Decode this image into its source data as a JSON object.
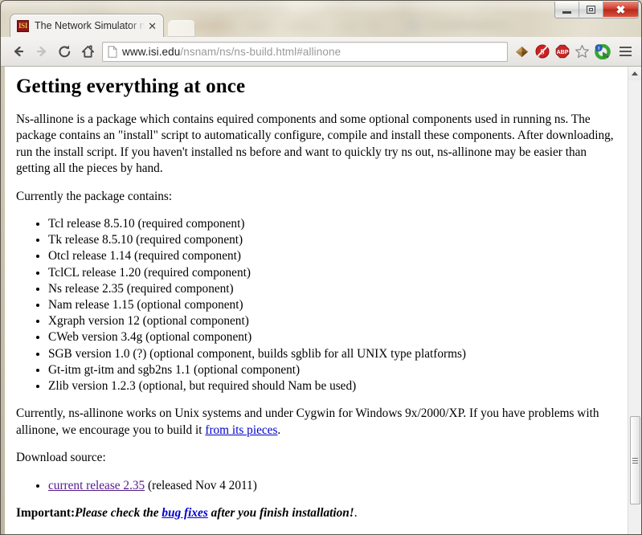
{
  "window": {
    "controls": [
      {
        "name": "minimize",
        "label": "–"
      },
      {
        "name": "restore",
        "label": "□"
      },
      {
        "name": "close",
        "label": "✕"
      }
    ]
  },
  "tab": {
    "favicon_text": "ISI",
    "favicon_name": "isi-favicon",
    "title": "The Network Simulator ns",
    "close_label": "✕",
    "newtab_label": ""
  },
  "toolbar": {
    "back_name": "back-icon",
    "forward_name": "forward-icon",
    "reload_name": "reload-icon",
    "home_name": "home-icon",
    "omnibox": {
      "page_icon_name": "page-document-icon",
      "url_domain": "www.isi.edu",
      "url_path": "/nsnam/ns/ns-build.html#allinone",
      "full_url": "www.isi.edu/nsnam/ns/ns-build.html#allinone"
    },
    "extensions": [
      {
        "name": "diamond-extension-icon",
        "color": "#a5763a"
      },
      {
        "name": "noscript-icon",
        "color": "#cc2222"
      },
      {
        "name": "adblock-plus-icon",
        "label": "ABP",
        "color": "#c62828"
      },
      {
        "name": "bookmark-star-icon",
        "color": "#8c8c8c"
      },
      {
        "name": "green-circle-extension-icon",
        "color": "#3fae3f"
      }
    ],
    "menu_name": "chrome-menu-icon"
  },
  "page": {
    "heading": "Getting everything at once",
    "intro": "Ns-allinone is a package which contains equired components and some optional components used in running ns. The package contains an \"install\" script to automatically configure, compile and install these components. After downloading, run the install script. If you haven't installed ns before and want to quickly try ns out, ns-allinone may be easier than getting all the pieces by hand.",
    "contains_lead": "Currently the package contains:",
    "components": [
      "Tcl release 8.5.10 (required component)",
      "Tk release 8.5.10 (required component)",
      "Otcl release 1.14 (required component)",
      "TclCL release 1.20 (required component)",
      "Ns release 2.35 (required component)",
      "Nam release 1.15 (optional component)",
      "Xgraph version 12 (optional component)",
      "CWeb version 3.4g (optional component)",
      "SGB version 1.0 (?) (optional component, builds sgblib for all UNIX type platforms)",
      "Gt-itm gt-itm and sgb2ns 1.1 (optional component)",
      "Zlib version 1.2.3 (optional, but required should Nam be used)"
    ],
    "platform_note_before": "Currently, ns-allinone works on Unix systems and under Cygwin for Windows 9x/2000/XP. If you have problems with allinone, we encourage you to build it ",
    "platform_note_link": "from its pieces",
    "platform_note_after": ".",
    "download_lead": "Download source:",
    "download_link": "current release 2.35",
    "download_after": " (released Nov 4 2011)",
    "important_label": "Important:",
    "important_before": "Please check the ",
    "important_link": "bug fixes",
    "important_after": " after you finish installation!",
    "important_period": "."
  },
  "scrollbar": {
    "up_arrow_name": "scroll-up-arrow",
    "thumb_name": "scroll-thumb"
  },
  "colors": {
    "link": "#0000cc",
    "visited_link": "#551a8b",
    "close_button": "#c0392b",
    "favicon_bg": "#8d1616",
    "favicon_fg": "#ecc23c"
  }
}
